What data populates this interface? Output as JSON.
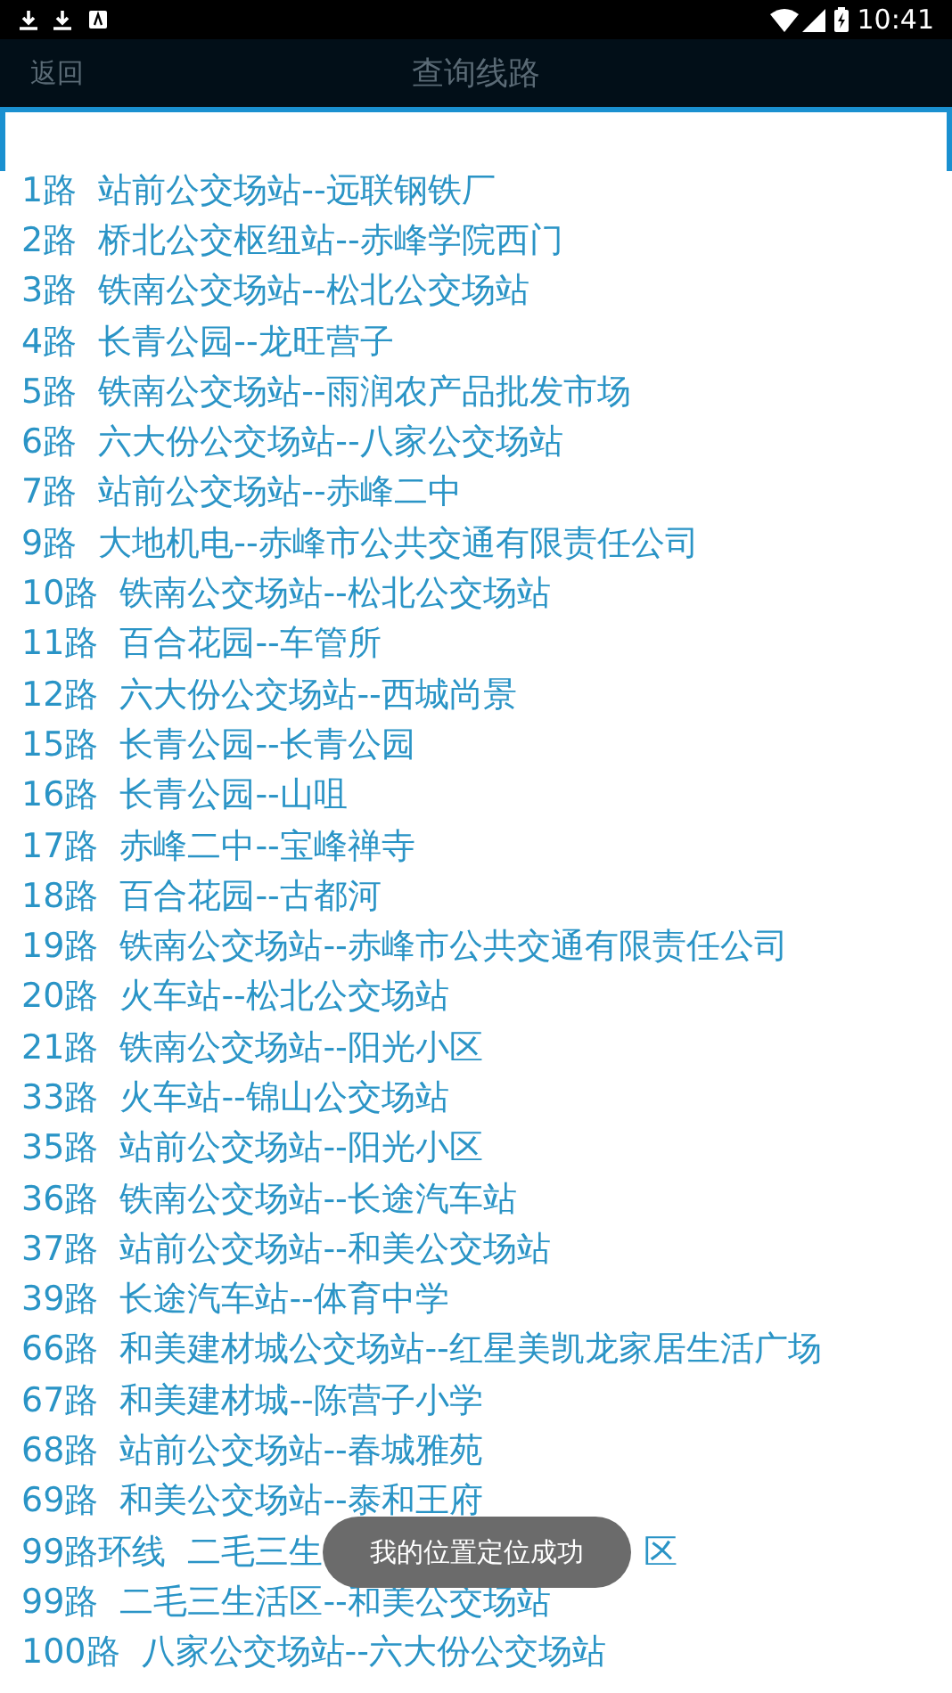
{
  "status_bar": {
    "time": "10:41"
  },
  "header": {
    "back": "返回",
    "title": "查询线路"
  },
  "routes": [
    {
      "route": "1路",
      "stops": "站前公交场站--远联钢铁厂"
    },
    {
      "route": "2路",
      "stops": "桥北公交枢纽站--赤峰学院西门"
    },
    {
      "route": "3路",
      "stops": "铁南公交场站--松北公交场站"
    },
    {
      "route": "4路",
      "stops": "长青公园--龙旺营子"
    },
    {
      "route": "5路",
      "stops": "铁南公交场站--雨润农产品批发市场"
    },
    {
      "route": "6路",
      "stops": "六大份公交场站--八家公交场站"
    },
    {
      "route": "7路",
      "stops": "站前公交场站--赤峰二中"
    },
    {
      "route": "9路",
      "stops": "大地机电--赤峰市公共交通有限责任公司"
    },
    {
      "route": "10路",
      "stops": "铁南公交场站--松北公交场站"
    },
    {
      "route": "11路",
      "stops": "百合花园--车管所"
    },
    {
      "route": "12路",
      "stops": "六大份公交场站--西城尚景"
    },
    {
      "route": "15路",
      "stops": "长青公园--长青公园"
    },
    {
      "route": "16路",
      "stops": "长青公园--山咀"
    },
    {
      "route": "17路",
      "stops": "赤峰二中--宝峰禅寺"
    },
    {
      "route": "18路",
      "stops": "百合花园--古都河"
    },
    {
      "route": "19路",
      "stops": "铁南公交场站--赤峰市公共交通有限责任公司"
    },
    {
      "route": "20路",
      "stops": "火车站--松北公交场站"
    },
    {
      "route": "21路",
      "stops": "铁南公交场站--阳光小区"
    },
    {
      "route": "33路",
      "stops": "火车站--锦山公交场站"
    },
    {
      "route": "35路",
      "stops": "站前公交场站--阳光小区"
    },
    {
      "route": "36路",
      "stops": "铁南公交场站--长途汽车站"
    },
    {
      "route": "37路",
      "stops": "站前公交场站--和美公交场站"
    },
    {
      "route": "39路",
      "stops": "长途汽车站--体育中学"
    },
    {
      "route": "66路",
      "stops": "和美建材城公交场站--红星美凯龙家居生活广场"
    },
    {
      "route": "67路",
      "stops": "和美建材城--陈营子小学"
    },
    {
      "route": "68路",
      "stops": "站前公交场站--春城雅苑"
    },
    {
      "route": "69路",
      "stops": "和美公交场站--泰和王府"
    },
    {
      "route": "99路环线",
      "stops_visible": [
        "二毛三生",
        "区"
      ]
    },
    {
      "route": "99路",
      "stops": "二毛三生活区--和美公交场站"
    },
    {
      "route": "100路",
      "stops": "八家公交场站--六大份公交场站"
    }
  ],
  "toast": "我的位置定位成功"
}
